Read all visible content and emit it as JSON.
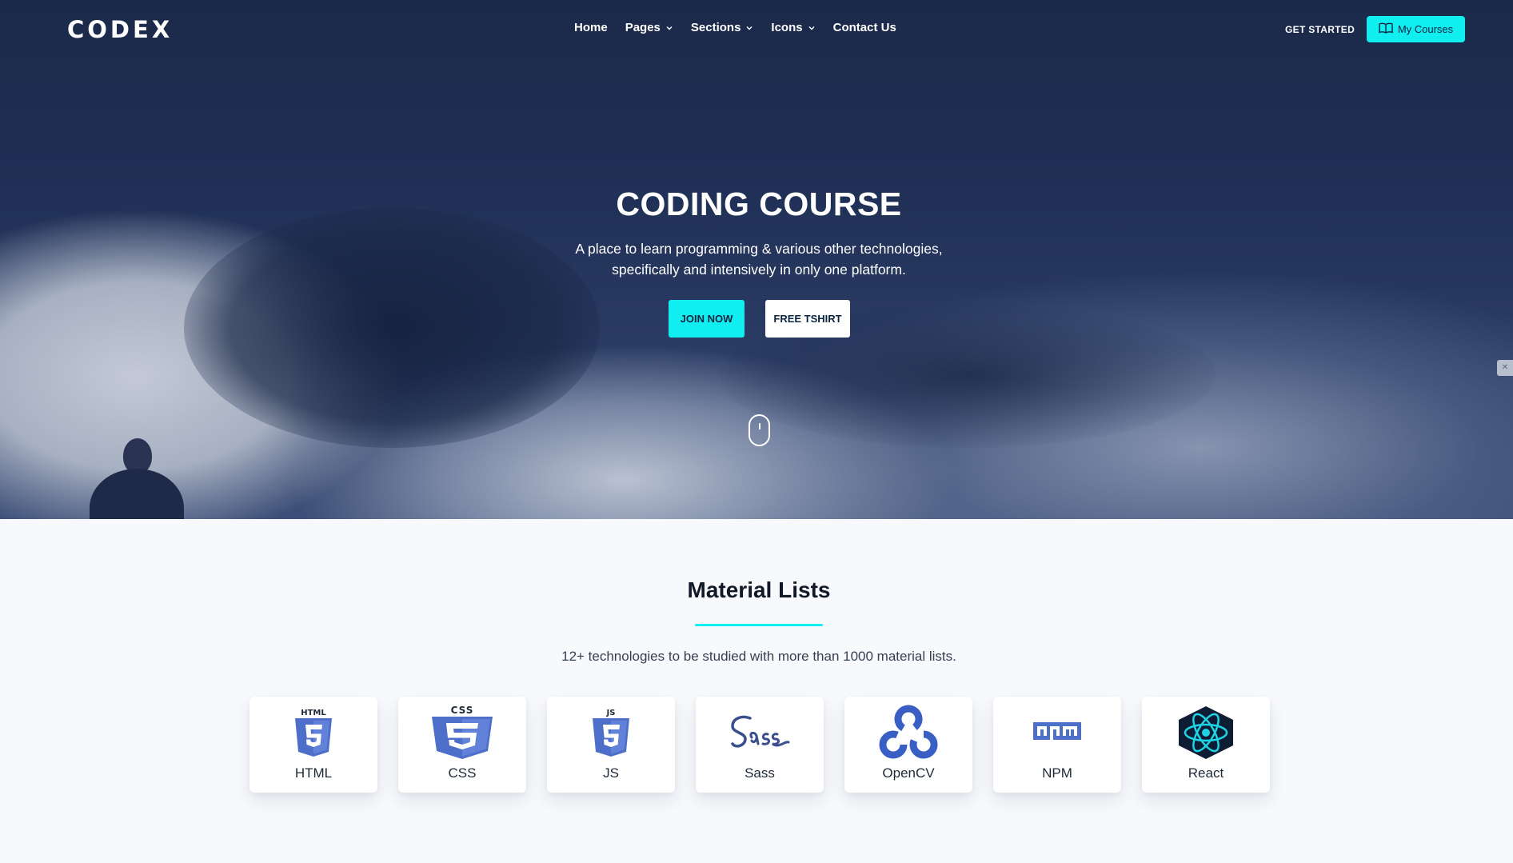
{
  "brand": {
    "logo_text": "CODEX"
  },
  "nav": {
    "items": [
      {
        "label": "Home",
        "dropdown": false
      },
      {
        "label": "Pages",
        "dropdown": true
      },
      {
        "label": "Sections",
        "dropdown": true
      },
      {
        "label": "Icons",
        "dropdown": true
      },
      {
        "label": "Contact Us",
        "dropdown": false
      }
    ],
    "get_started": "GET STARTED",
    "my_courses": "My Courses"
  },
  "hero": {
    "title": "CODING COURSE",
    "subtitle_line1": "A place to learn programming & various other technologies,",
    "subtitle_line2": "specifically and intensively in only one platform.",
    "join_button": "JOIN NOW",
    "tshirt_button": "FREE TSHIRT"
  },
  "materials": {
    "title": "Material Lists",
    "subtitle": "12+ technologies to be studied with more than 1000 material lists.",
    "items": [
      {
        "label": "HTML",
        "icon": "html5-icon"
      },
      {
        "label": "CSS",
        "icon": "css3-icon"
      },
      {
        "label": "JS",
        "icon": "js-icon"
      },
      {
        "label": "Sass",
        "icon": "sass-icon"
      },
      {
        "label": "OpenCV",
        "icon": "opencv-icon"
      },
      {
        "label": "NPM",
        "icon": "npm-icon"
      },
      {
        "label": "React",
        "icon": "react-icon"
      }
    ]
  },
  "colors": {
    "accent": "#11eef0",
    "hero_dark": "#1f2f55",
    "icon_blue": "#4e6fc9",
    "text_dark": "#111827"
  }
}
